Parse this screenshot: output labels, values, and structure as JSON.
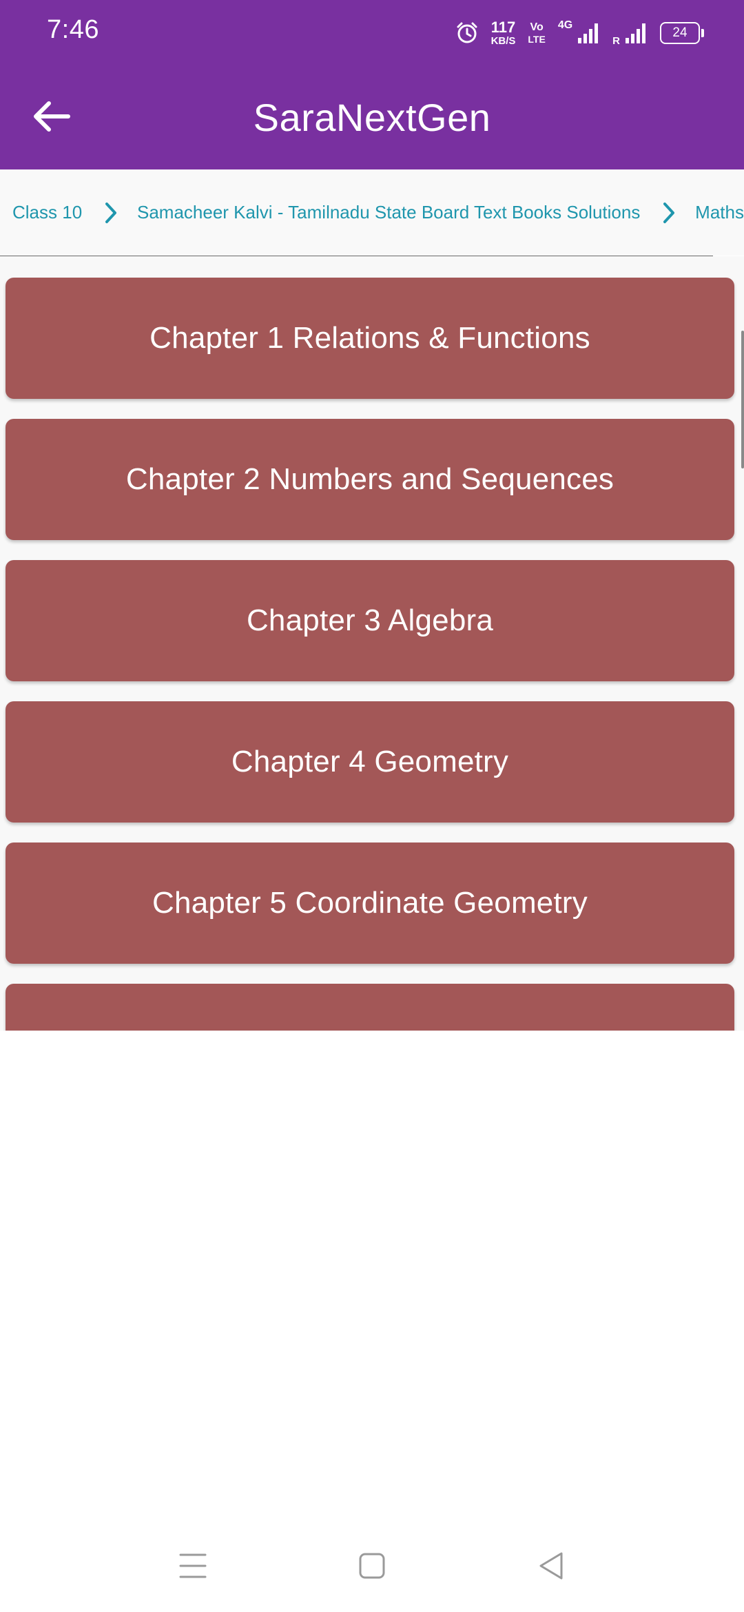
{
  "status_bar": {
    "time": "7:46",
    "net_speed_value": "117",
    "net_speed_unit": "KB/S",
    "volte_top": "Vo",
    "volte_bottom": "LTE",
    "network_type": "4G",
    "roaming": "R",
    "battery": "24"
  },
  "app_bar": {
    "title": "SaraNextGen",
    "back_icon": "arrow-left-icon"
  },
  "breadcrumb": [
    "Class 10",
    "Samacheer Kalvi - Tamilnadu State Board Text Books Solutions",
    "Maths"
  ],
  "chapters": [
    "Chapter 1 Relations & Functions",
    "Chapter 2 Numbers and Sequences",
    "Chapter 3 Algebra",
    "Chapter 4 Geometry",
    "Chapter 5 Coordinate Geometry",
    ""
  ],
  "nav_bar": {
    "icons": [
      "menu-icon",
      "home-icon",
      "back-icon"
    ]
  },
  "colors": {
    "app_bar": "#7930a0",
    "card": "#a35757",
    "breadcrumb_text": "#1f96ad"
  }
}
